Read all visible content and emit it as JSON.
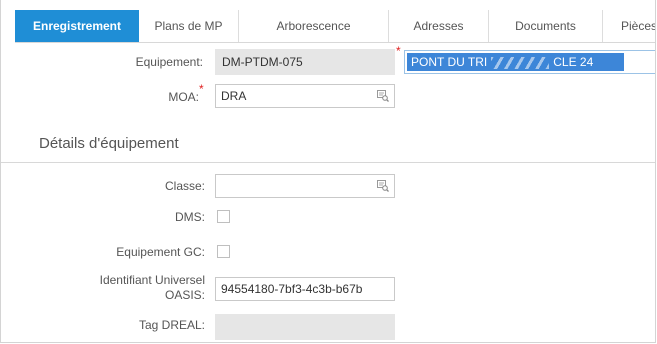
{
  "tabs": [
    {
      "label": "Enregistrement",
      "active": true
    },
    {
      "label": "Plans de MP",
      "active": false
    },
    {
      "label": "Arborescence",
      "active": false
    },
    {
      "label": "Adresses",
      "active": false
    },
    {
      "label": "Documents",
      "active": false
    },
    {
      "label": "Pièces",
      "active": false
    }
  ],
  "equipement": {
    "label": "Equipement:",
    "value": "DM-PTDM-075",
    "description_part1": "PONT DU TRI",
    "description_part2": "CLE 24"
  },
  "moa": {
    "label": "MOA:",
    "value": "DRA"
  },
  "section_title": "Détails d'équipement",
  "classe": {
    "label": "Classe:",
    "value": ""
  },
  "dms": {
    "label": "DMS:",
    "checked": false
  },
  "equipement_gc": {
    "label": "Equipement GC:",
    "checked": false
  },
  "identifiant": {
    "label_line1": "Identifiant Universel",
    "label_line2": "OASIS:",
    "value": "94554180-7bf3-4c3b-b67b"
  },
  "tag_dreal": {
    "label": "Tag DREAL:",
    "value": ""
  },
  "colors": {
    "accent": "#1f8ed6",
    "selection": "#3d86d8",
    "required": "#e02020"
  }
}
